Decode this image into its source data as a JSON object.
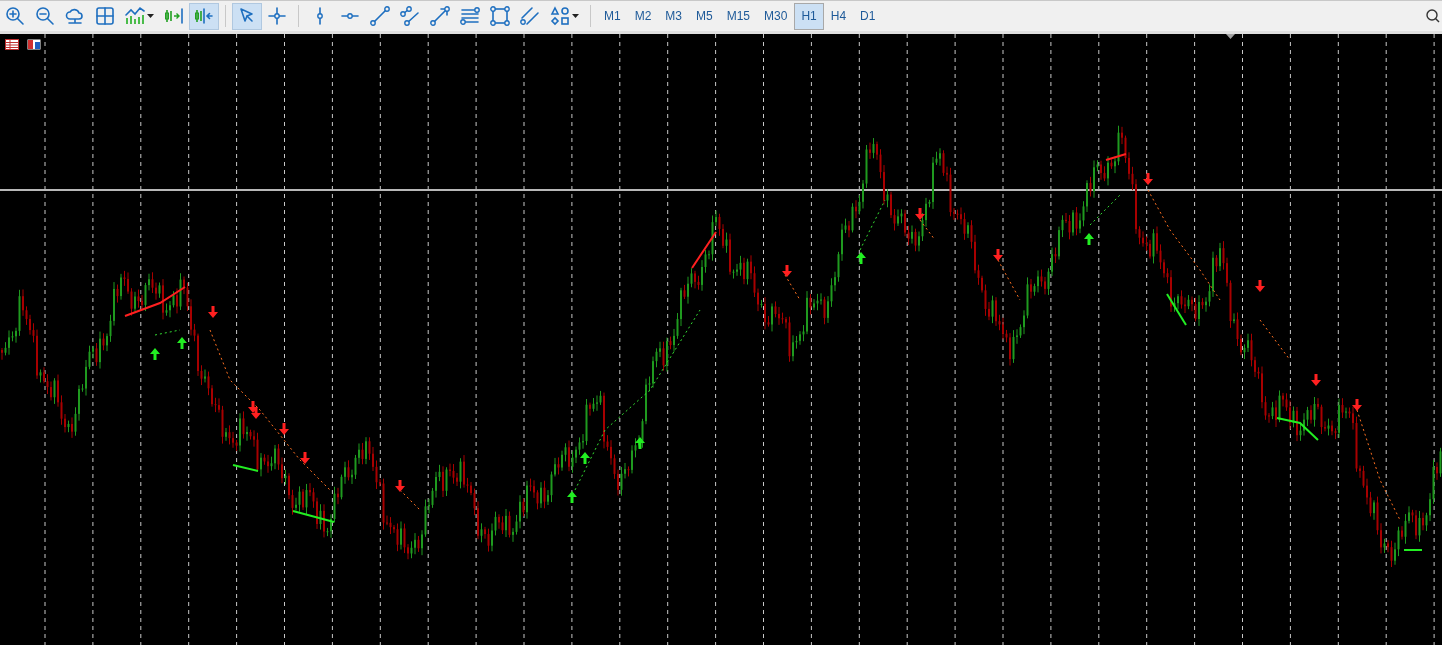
{
  "toolbar": {
    "groups": [
      {
        "tools": [
          {
            "kind": "zoomin",
            "selected": false,
            "dropdown": false
          },
          {
            "kind": "zoomout",
            "selected": false,
            "dropdown": false
          },
          {
            "kind": "cloud",
            "selected": false,
            "dropdown": false
          },
          {
            "kind": "grid",
            "selected": false,
            "dropdown": false
          },
          {
            "kind": "bars",
            "selected": false,
            "dropdown": true
          },
          {
            "kind": "shiftend",
            "selected": false,
            "dropdown": false
          },
          {
            "kind": "autoscroll",
            "selected": true,
            "dropdown": false
          }
        ]
      },
      {
        "tools": [
          {
            "kind": "cursor",
            "selected": true,
            "dropdown": false
          },
          {
            "kind": "crosshair",
            "selected": false,
            "dropdown": false
          }
        ]
      },
      {
        "tools": [
          {
            "kind": "vline",
            "selected": false,
            "dropdown": false
          },
          {
            "kind": "hline",
            "selected": false,
            "dropdown": false
          },
          {
            "kind": "trendline",
            "selected": false,
            "dropdown": false
          },
          {
            "kind": "twolines",
            "selected": false,
            "dropdown": false
          },
          {
            "kind": "arrowline",
            "selected": false,
            "dropdown": false
          },
          {
            "kind": "levels",
            "selected": false,
            "dropdown": false
          },
          {
            "kind": "rectangle",
            "selected": false,
            "dropdown": false
          },
          {
            "kind": "channel",
            "selected": false,
            "dropdown": false
          },
          {
            "kind": "shapes",
            "selected": false,
            "dropdown": true
          }
        ]
      }
    ]
  },
  "timeframes": [
    {
      "label": "M1",
      "selected": false
    },
    {
      "label": "M2",
      "selected": false
    },
    {
      "label": "M3",
      "selected": false
    },
    {
      "label": "M5",
      "selected": false
    },
    {
      "label": "M15",
      "selected": false
    },
    {
      "label": "M30",
      "selected": false
    },
    {
      "label": "H1",
      "selected": true
    },
    {
      "label": "H4",
      "selected": false
    },
    {
      "label": "D1",
      "selected": false
    }
  ]
}
